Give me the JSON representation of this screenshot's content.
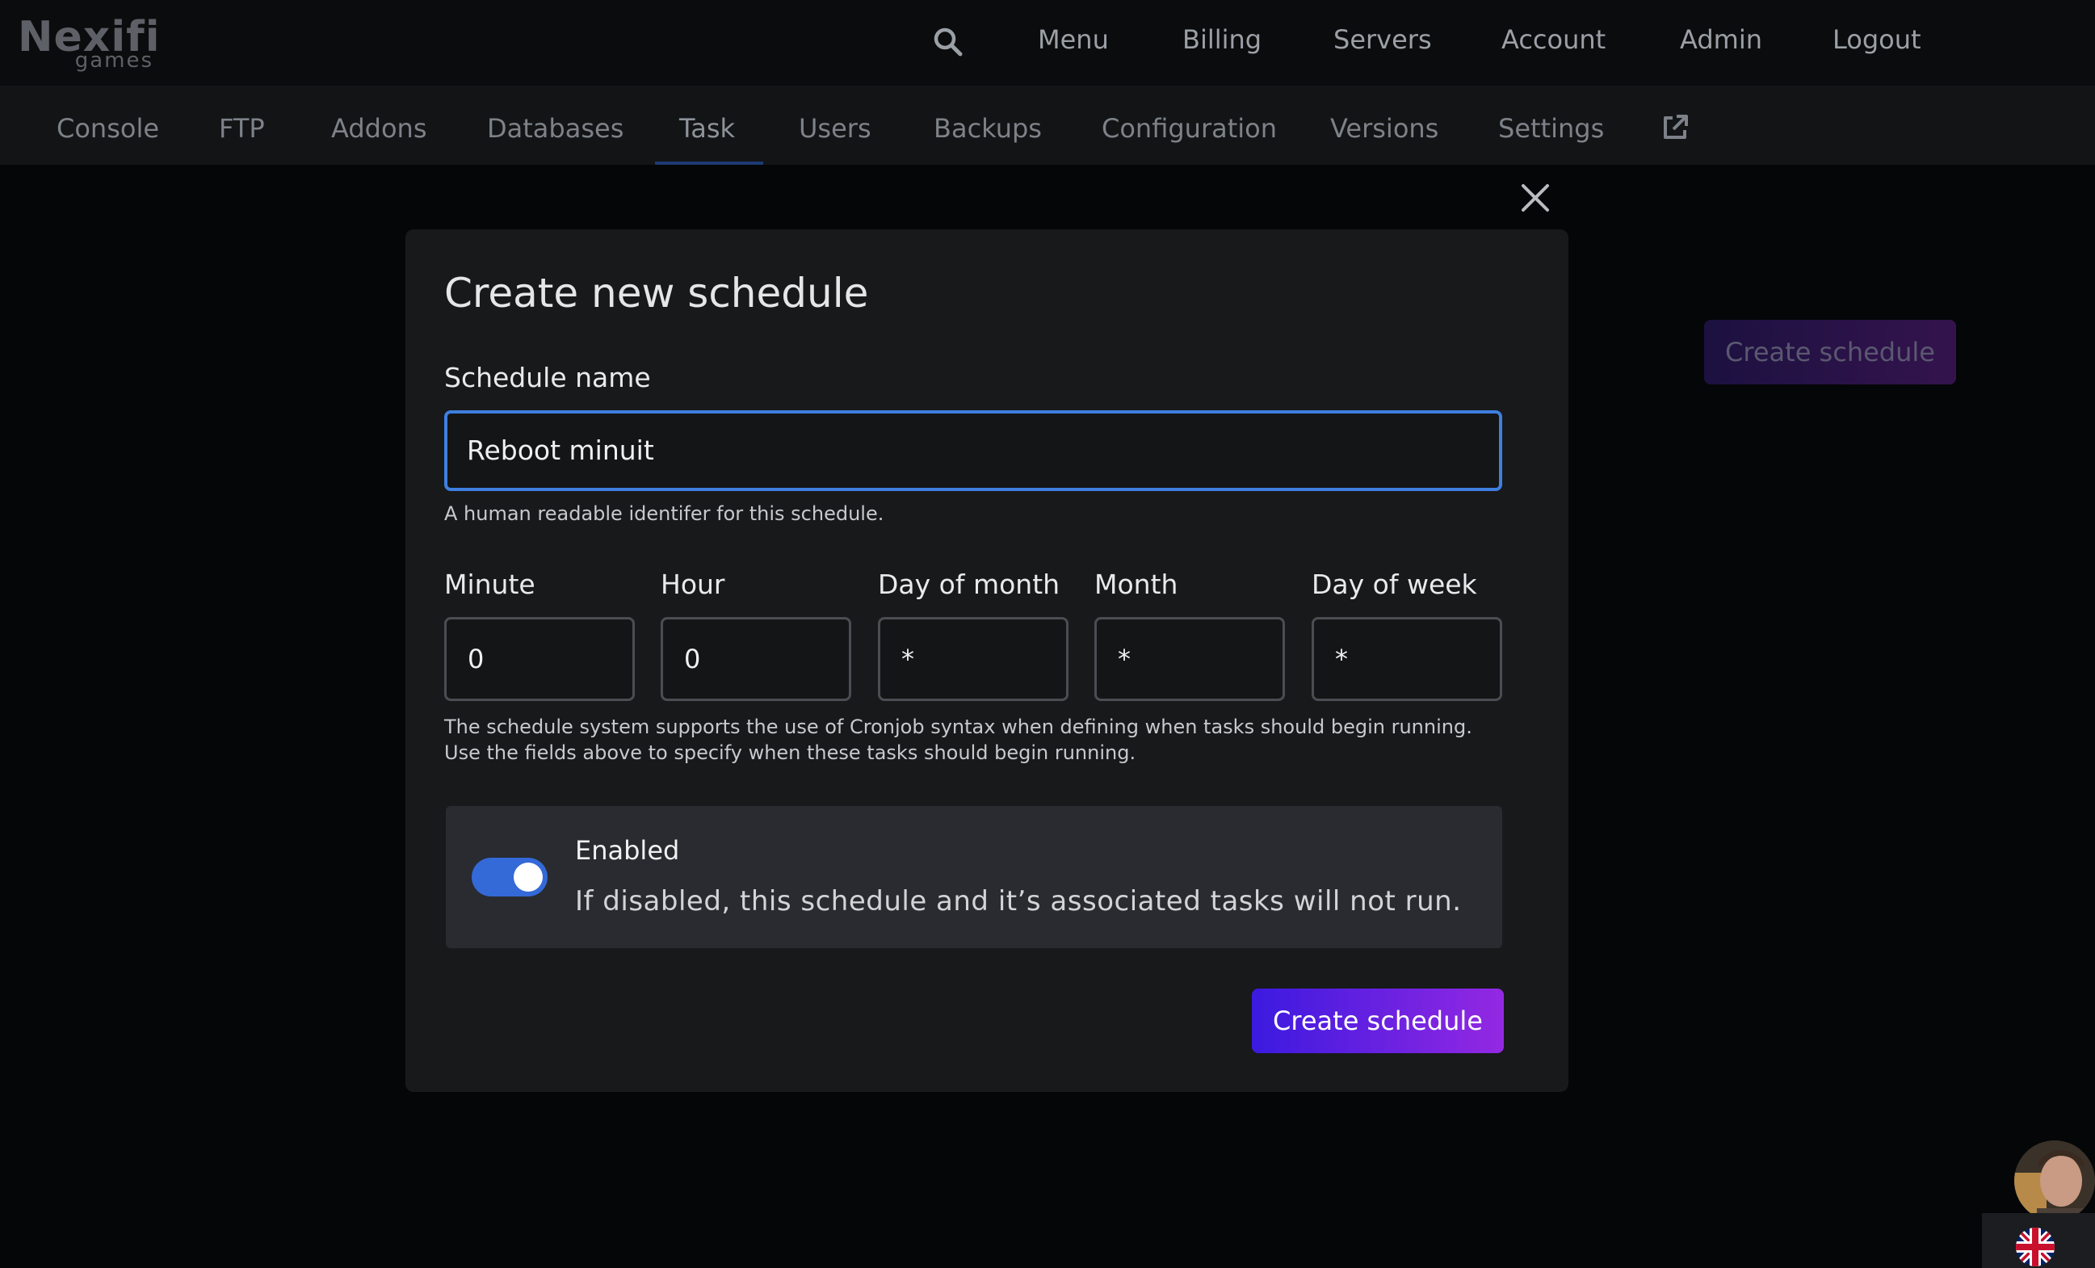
{
  "brand": {
    "logo_main": "Nexifi",
    "logo_sub": "games"
  },
  "topnav": {
    "items": [
      "Menu",
      "Billing",
      "Servers",
      "Account",
      "Admin",
      "Logout"
    ]
  },
  "tabs": {
    "items": [
      "Console",
      "FTP",
      "Addons",
      "Databases",
      "Task",
      "Users",
      "Backups",
      "Configuration",
      "Versions",
      "Settings"
    ],
    "active": "Task"
  },
  "page": {
    "create_button_label": "Create schedule"
  },
  "modal": {
    "title": "Create new schedule",
    "name_label": "Schedule name",
    "name_value": "Reboot minuit",
    "name_helper": "A human readable identifer for this schedule.",
    "cron": {
      "minute_label": "Minute",
      "minute_value": "0",
      "hour_label": "Hour",
      "hour_value": "0",
      "day_of_month_label": "Day of month",
      "day_of_month_value": "*",
      "month_label": "Month",
      "month_value": "*",
      "day_of_week_label": "Day of week",
      "day_of_week_value": "*"
    },
    "cron_helper_line1": "The schedule system supports the use of Cronjob syntax when defining when tasks should begin running.",
    "cron_helper_line2": "Use the fields above to specify when these tasks should begin running.",
    "enabled_title": "Enabled",
    "enabled_desc": "If disabled, this schedule and it’s associated tasks will not run.",
    "enabled_state": true,
    "submit_label": "Create schedule"
  },
  "icons": {
    "search": "search-icon",
    "external": "external-link-icon",
    "close": "close-icon",
    "flag": "uk-flag-icon"
  },
  "colors": {
    "accent_blue": "#3469d8",
    "button_gradient_start": "#3b1ae0",
    "button_gradient_end": "#9428e2"
  }
}
